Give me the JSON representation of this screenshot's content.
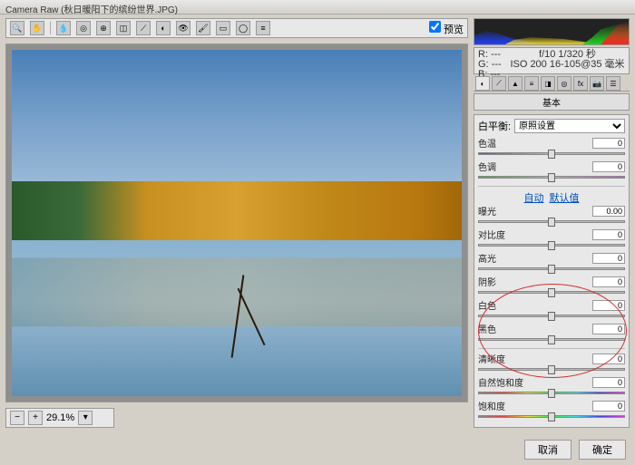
{
  "window": {
    "title": "Camera Raw (秋日暖阳下的缤纷世界.JPG)"
  },
  "toolbar": {
    "preview_label": "预览"
  },
  "zoom": {
    "level": "29.1%"
  },
  "info": {
    "r_label": "R:",
    "g_label": "G:",
    "b_label": "B:",
    "r": "---",
    "g": "---",
    "b": "---",
    "exposure": "f/10  1/320 秒",
    "iso": "ISO 200  16-105@35 毫米"
  },
  "panel": {
    "title": "基本"
  },
  "wb": {
    "label": "白平衡:",
    "preset": "原照设置"
  },
  "sliders": {
    "temp": {
      "label": "色温",
      "value": "0",
      "pos": 50
    },
    "tint": {
      "label": "色调",
      "value": "0",
      "pos": 50
    },
    "auto": {
      "label": "自动",
      "default_label": "默认值"
    },
    "exposure": {
      "label": "曝光",
      "value": "0.00",
      "pos": 50
    },
    "contrast": {
      "label": "对比度",
      "value": "0",
      "pos": 50
    },
    "highlights": {
      "label": "高光",
      "value": "0",
      "pos": 50
    },
    "shadows": {
      "label": "阴影",
      "value": "0",
      "pos": 50
    },
    "whites": {
      "label": "白色",
      "value": "0",
      "pos": 50
    },
    "blacks": {
      "label": "黑色",
      "value": "0",
      "pos": 50
    },
    "clarity": {
      "label": "清晰度",
      "value": "0",
      "pos": 50
    },
    "vibrance": {
      "label": "自然饱和度",
      "value": "0",
      "pos": 50
    },
    "saturation": {
      "label": "饱和度",
      "value": "0",
      "pos": 50
    }
  },
  "footer": {
    "cancel": "取消",
    "ok": "确定"
  }
}
